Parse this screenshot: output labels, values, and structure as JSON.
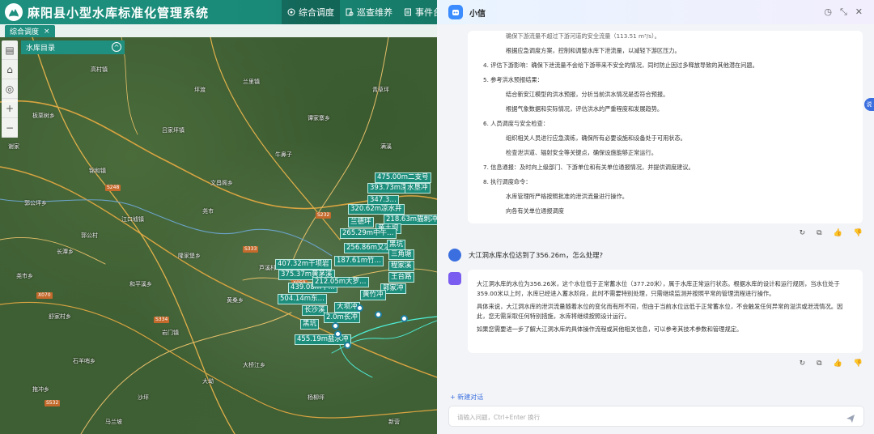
{
  "header": {
    "title": "麻阳县小型水库标准化管理系统",
    "nav": [
      {
        "label": "综合调度",
        "icon": "compass-icon",
        "active": true
      },
      {
        "label": "巡查维养",
        "icon": "inspect-icon",
        "active": false
      },
      {
        "label": "事件台账",
        "icon": "ledger-icon",
        "active": false
      }
    ]
  },
  "tabs": [
    {
      "label": "综合调度",
      "close": "×"
    }
  ],
  "map": {
    "directory_label": "水库目录",
    "tools": [
      "layers-icon",
      "home-icon",
      "locate-icon",
      "zoom-in-icon",
      "zoom-out-icon"
    ],
    "places": [
      "高村镇",
      "兰里镇",
      "板栗树乡",
      "吕家坪镇",
      "谭家寨乡",
      "锦和镇",
      "文昌阁乡",
      "郭公坪乡",
      "江口墟镇",
      "长潭乡",
      "隆家堡乡",
      "尧市乡",
      "和平溪乡",
      "黄桑乡",
      "舒家村乡",
      "岩门镇",
      "石羊哨乡",
      "大桥江乡",
      "拖冲乡",
      "沙坪",
      "杨柳坪",
      "马兰坡",
      "青草坪",
      "满溪",
      "牛鼻子",
      "坪渡",
      "谢家",
      "郭公村",
      "尧市",
      "芦溪村",
      "大坳",
      "新营"
    ],
    "road_shields": [
      "S232",
      "S248",
      "S334",
      "S333",
      "X070",
      "X059",
      "S532"
    ],
    "reservoir_labels": [
      "475.00m二支号",
      "393.73m深坑冲",
      "347.3…",
      "水垦冲",
      "320.62m凉水井",
      "218.63m猫刺冲",
      "兰德坪",
      "黄土坝",
      "265.29m中午…",
      "256.86m又溪",
      "187.61m竹…",
      "黑坑",
      "407.32m干坝岩",
      "375.37m黄茅溪",
      "439.08m干…",
      "212.05m大罗…",
      "504.14m东…",
      "大坝冲",
      "长沙溪",
      "黑坑",
      "455.19m盐水冲",
      "三角塘",
      "程家溪",
      "王台路",
      "郭家冲",
      "黄竹冲",
      "2.0m长冲"
    ]
  },
  "chat": {
    "title": "小信",
    "head_icons": [
      "history-icon",
      "collapse-icon",
      "close-icon"
    ],
    "answer1": [
      {
        "text": "确保下游流量不超过下游河道的安全流量（113.51 m³/s）。",
        "style": "sub"
      },
      {
        "text": "根据应急调度方案，控制和调整水库下泄流量，以减轻下游区压力。",
        "style": "sub"
      },
      {
        "text": "4. 评估下游影响：确保下泄流量不会给下游带来不安全的情况，同时防止因过多释放导致的其他潜在问题。",
        "style": "num"
      },
      {
        "text": "5. 参考洪水预报结果：",
        "style": "num"
      },
      {
        "text": "结合新安江模型的洪水预报，分析当前洪水情况是否符合预报。",
        "style": "sub"
      },
      {
        "text": "根据气象数据和实际情况，评估洪水的严重程度和发展趋势。",
        "style": "sub"
      },
      {
        "text": "6. 人员调度与安全检查：",
        "style": "num"
      },
      {
        "text": "组织相关人员进行应急演练，确保所有必要设施和设备处于可用状态。",
        "style": "sub"
      },
      {
        "text": "检查泄洪道、辐射安全等关键点，确保设施能够正常运行。",
        "style": "sub"
      },
      {
        "text": "7. 信息通报：及时向上级部门、下游单位和有关单位通报情况，并提供调度建议。",
        "style": "num"
      },
      {
        "text": "8. 执行调度命令：",
        "style": "num"
      },
      {
        "text": "水库管理所严格按照批准的泄洪流量进行操作。",
        "style": "sub"
      },
      {
        "text": "向各有关单位通报调度",
        "style": "sub"
      }
    ],
    "question": "大江洞水库水位达到了356.26m，怎么处理?",
    "answer2": [
      "大江洞水库的水位为356.26米，这个水位低于正常蓄水位（377.20米），属于水库正常运行状态。根据水库的设计和运行规则，当水位处于359.00米以上时，水库已经进入蓄水阶段，此时不需要特别处理，只需继续监测并按照平常的管理流程进行操作。",
      "具体来说，大江洞水库的泄洪流量随着水位的变化而有所不同，但由于当前水位远低于正常蓄水位，不会触发任何异常的溢洪或泄流情况。因此，您无需采取任何特别措施，水库将继续按照设计运行。",
      "如果您需要进一步了解大江洞水库的具体操作流程或其他相关信息，可以参考其技术参数和管理规定。"
    ],
    "actions": [
      "refresh-icon",
      "copy-icon",
      "thumbs-up-icon",
      "thumbs-down-icon"
    ],
    "new_chat": "+ 新建对话",
    "input_placeholder": "请输入问题，Ctrl+Enter 换行",
    "float_label": "说"
  }
}
